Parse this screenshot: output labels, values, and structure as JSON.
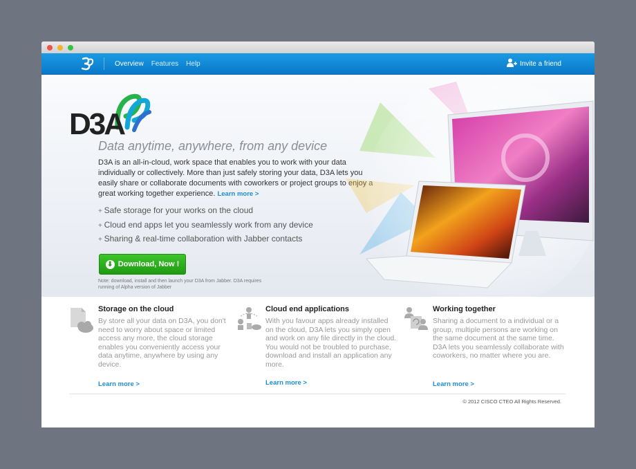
{
  "nav": {
    "links": [
      "Overview",
      "Features",
      "Help"
    ],
    "invite_label": "Invite a friend"
  },
  "hero": {
    "tagline": "Data anytime, anywhere, from any device",
    "description": "D3A is an all-in-cloud, work space that enables you to work with your data individually or collectively.  More than just safely storing your data, D3A lets you easily share or collaborate documents with coworkers or project groups to enjoy a great working together experience.",
    "learn_more": "Learn more >",
    "features": [
      "Safe storage for your works on the cloud",
      "Cloud end apps let you seamlessly work from any device",
      "Sharing & real-time collaboration with Jabber contacts"
    ],
    "download_label": "Download, Now !",
    "note": "Note: download, install and then launch your D3A from Jabber. D3A requires running of Alpha version of Jabber"
  },
  "columns": [
    {
      "title": "Storage on the cloud",
      "body": "By store all your data on D3A, you don't need to worry about space or limited access any more, the cloud storage enables you conveniently access your data anytime, anywhere by using any device.",
      "link": "Learn more >"
    },
    {
      "title": "Cloud end applications",
      "body": "With you favour apps already installed on the cloud, D3A lets you simply open and work on any file directly in the cloud. You would not be troubled to purchase, download and install an application any more.",
      "link": "Learn more >"
    },
    {
      "title": "Working together",
      "body": "Sharing a document to a individual or a group, multiple persons are working on the same document at the same time. D3A lets you seamlessly collaborate with coworkers, no matter where you are.",
      "link": "Learn more >"
    }
  ],
  "footer": {
    "copyright": "© 2012 CISCO CTEO All Rights Reserved."
  },
  "colors": {
    "nav_blue": "#0a78c9",
    "link_blue": "#1c8ed8",
    "download_green": "#24a016"
  }
}
